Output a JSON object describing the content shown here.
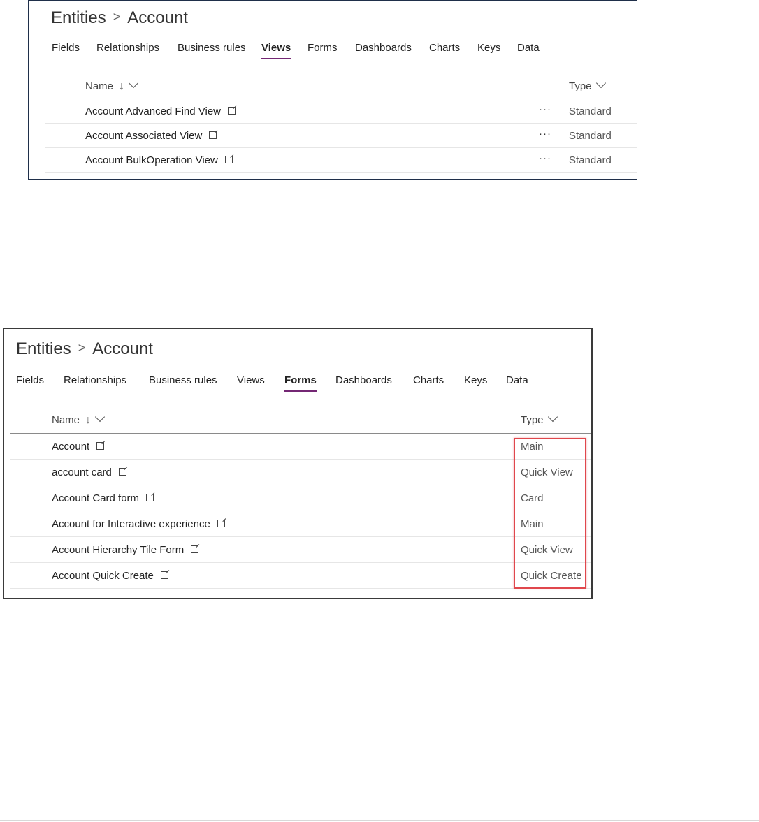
{
  "panel1": {
    "breadcrumb": {
      "parent": "Entities",
      "separator": ">",
      "current": "Account"
    },
    "tabs": [
      "Fields",
      "Relationships",
      "Business rules",
      "Views",
      "Forms",
      "Dashboards",
      "Charts",
      "Keys",
      "Data"
    ],
    "active_tab": "Views",
    "columns": {
      "name": "Name",
      "type": "Type"
    },
    "row_actions_label": "···",
    "rows": [
      {
        "name": "Account Advanced Find View",
        "type": "Standard"
      },
      {
        "name": "Account Associated View",
        "type": "Standard"
      },
      {
        "name": "Account BulkOperation View",
        "type": "Standard"
      }
    ]
  },
  "panel2": {
    "breadcrumb": {
      "parent": "Entities",
      "separator": ">",
      "current": "Account"
    },
    "tabs": [
      "Fields",
      "Relationships",
      "Business rules",
      "Views",
      "Forms",
      "Dashboards",
      "Charts",
      "Keys",
      "Data"
    ],
    "active_tab": "Forms",
    "columns": {
      "name": "Name",
      "type": "Type"
    },
    "rows": [
      {
        "name": "Account",
        "type": "Main"
      },
      {
        "name": "account card",
        "type": "Quick View"
      },
      {
        "name": "Account Card form",
        "type": "Card"
      },
      {
        "name": "Account for Interactive experience",
        "type": "Main"
      },
      {
        "name": "Account Hierarchy Tile Form",
        "type": "Quick View"
      },
      {
        "name": "Account Quick Create",
        "type": "Quick Create"
      }
    ]
  },
  "colors": {
    "accent": "#742774",
    "highlight": "#e0474c",
    "border": "#1f2f4a"
  }
}
